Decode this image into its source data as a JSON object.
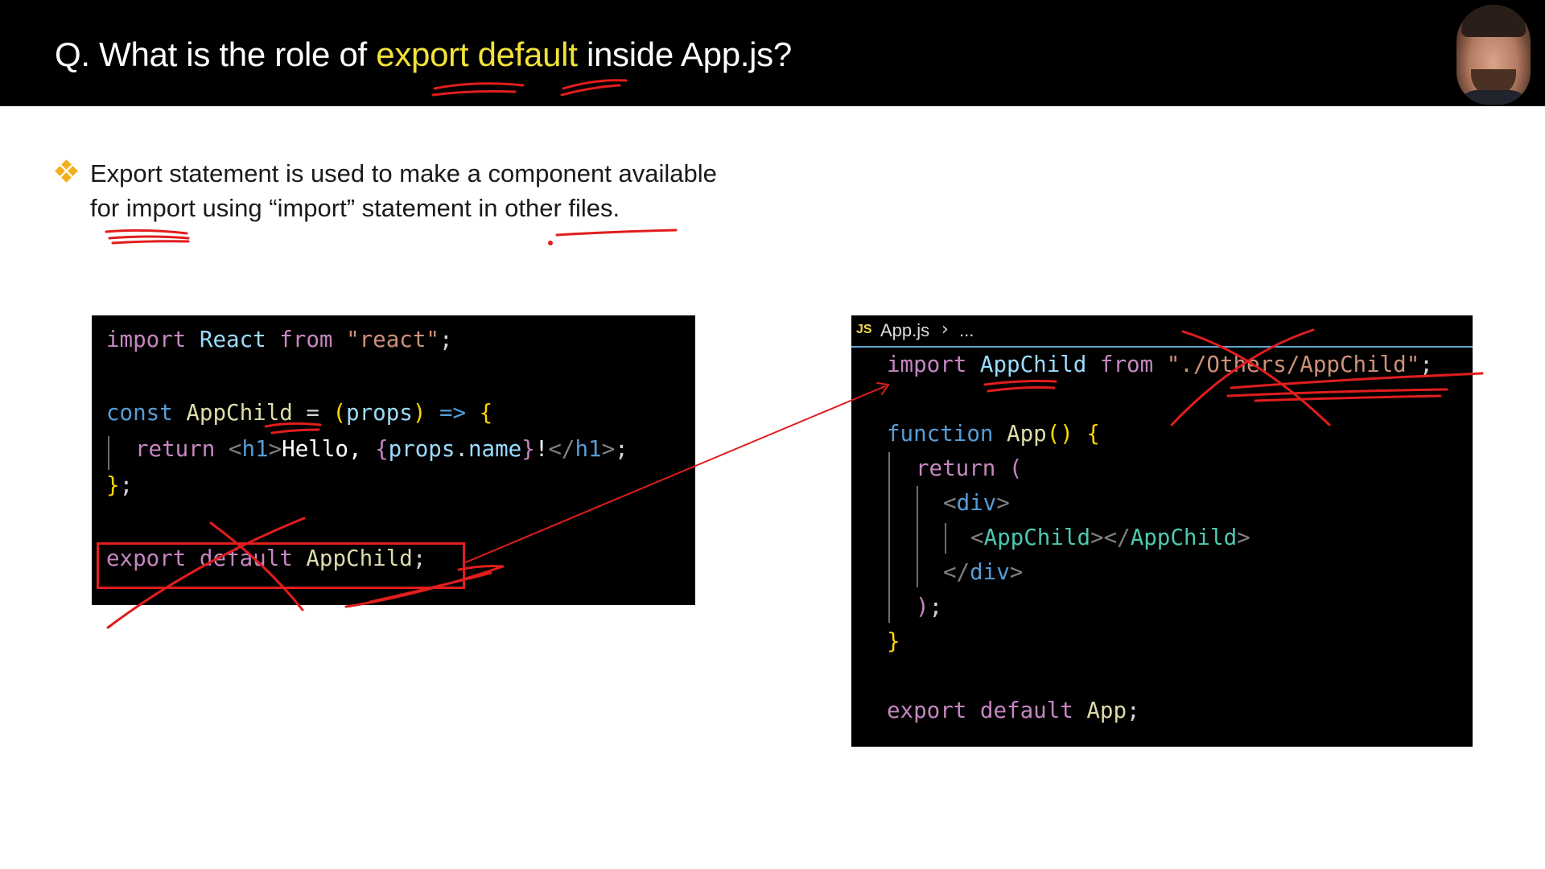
{
  "title": {
    "prefix": "Q. What is the role of ",
    "highlight": "export default",
    "suffix": " inside App.js?"
  },
  "bullet": {
    "line1": "Export statement is used to make a component available",
    "line2": "for import using “import” statement in other files."
  },
  "code_left": {
    "l1": {
      "a": "import",
      "b": "React",
      "c": "from",
      "d": "\"react\"",
      "e": ";"
    },
    "l3": {
      "a": "const",
      "b": "AppChild",
      "c": " = ",
      "d": "(",
      "e": "props",
      "f": ")",
      "g": " => ",
      "h": "{"
    },
    "l4": {
      "a": "return",
      "b": "<",
      "c": "h1",
      "d": ">",
      "e": "Hello, ",
      "f": "{",
      "g": "props",
      "h": ".",
      "i": "name",
      "j": "}",
      "k": "!",
      "l": "</",
      "m": "h1",
      "n": ">",
      "o": ";"
    },
    "l5": {
      "a": "}",
      "b": ";"
    },
    "l7": {
      "a": "export",
      "b": "default",
      "c": "AppChild",
      "d": ";"
    }
  },
  "code_right": {
    "tab": {
      "icon": "JS",
      "file": "App.js",
      "chevron": "›",
      "ellipsis": "..."
    },
    "l1": {
      "a": "import",
      "b": "AppChild",
      "c": "from",
      "d": "\"./Others/AppChild\"",
      "e": ";"
    },
    "l3": {
      "a": "function",
      "b": "App",
      "c": "()",
      "d": "{"
    },
    "l4": {
      "a": "return",
      "b": "("
    },
    "l5": {
      "a": "<",
      "b": "div",
      "c": ">"
    },
    "l6": {
      "a": "<",
      "b": "AppChild",
      "c": "></",
      "d": "AppChild",
      "e": ">"
    },
    "l7": {
      "a": "</",
      "b": "div",
      "c": ">"
    },
    "l8": {
      "a": ")",
      "b": ";"
    },
    "l9": {
      "a": "}"
    },
    "l11": {
      "a": "export",
      "b": "default",
      "c": "App",
      "d": ";"
    }
  },
  "colors": {
    "title_highlight": "#f3e23a",
    "bullet": "#f2b01e",
    "annotation": "#e11d1d",
    "code_bg": "#000000"
  }
}
